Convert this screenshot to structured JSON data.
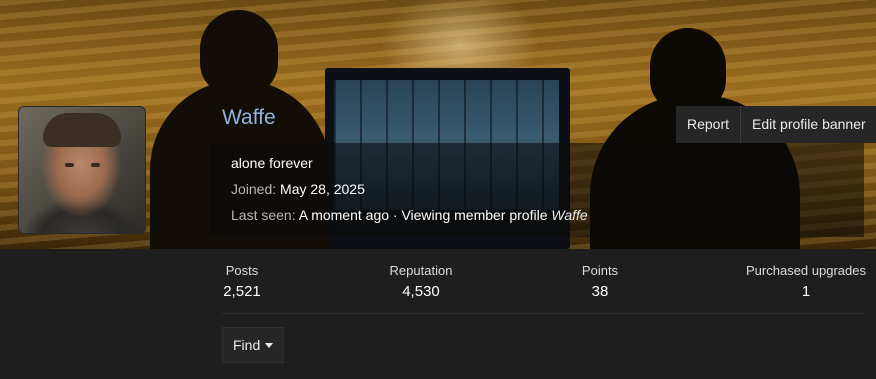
{
  "profile": {
    "username": "Waffe",
    "status_text": "alone forever",
    "joined_label": "Joined:",
    "joined_value": "May 28, 2025",
    "last_seen_label": "Last seen:",
    "last_seen_value": "A moment ago · Viewing member profile",
    "last_seen_target": "Waffe"
  },
  "banner_actions": {
    "report_label": "Report",
    "edit_banner_label": "Edit profile banner"
  },
  "stats": [
    {
      "label": "Posts",
      "value": "2,521"
    },
    {
      "label": "Reputation",
      "value": "4,530"
    },
    {
      "label": "Points",
      "value": "38"
    },
    {
      "label": "Purchased upgrades",
      "value": "1"
    }
  ],
  "find": {
    "label": "Find",
    "icon": "caret-down-icon"
  },
  "colors": {
    "username": "#8fb4e0",
    "page_background": "#1e1e1e",
    "button_background": "#262626"
  }
}
